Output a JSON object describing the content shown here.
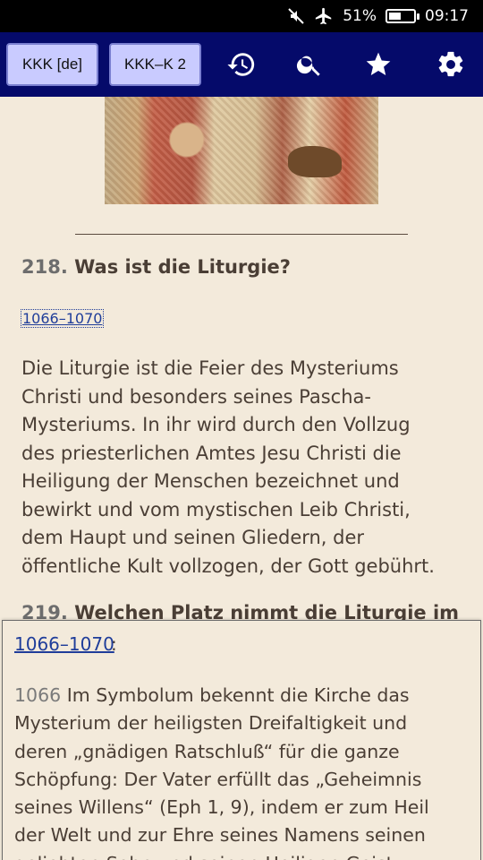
{
  "status_bar": {
    "battery_percent": "51%",
    "battery_level": 0.51,
    "time": "09:17",
    "icons": [
      "mute-icon",
      "airplane-icon",
      "battery-icon"
    ]
  },
  "toolbar": {
    "button_1": "KKK [de]",
    "button_2": "KKK–K 2",
    "icons": [
      "history-icon",
      "search-icon",
      "star-icon",
      "settings-icon"
    ]
  },
  "content": {
    "question_number": "218.",
    "question_title": "Was ist die Liturgie?",
    "reference_link": "1066–1070",
    "answer_lines": [
      "Die Liturgie ist die Feier des Mysteriums",
      "Christi und besonders seines Pascha-",
      "Mysteriums. In ihr wird durch den Vollzug",
      "des priesterlichen Amtes Jesu Christi die",
      "Heiligung der Menschen bezeichnet und",
      "bewirkt und vom mystischen Leib Christi,",
      "dem Haupt und seinen Gliedern, der",
      "öffentliche Kult vollzogen, der Gott gebührt."
    ],
    "next_question_number": "219.",
    "next_question_title": "Welchen Platz nimmt die Liturgie im"
  },
  "popup": {
    "link": "1066–1070",
    "colon": ":",
    "paragraph_number": "1066",
    "lines": [
      "Im Symbolum bekennt die Kirche das",
      "Mysterium der heiligsten Dreifaltigkeit und",
      "deren „gnädigen Ratschluß“ für die ganze",
      "Schöpfung: Der Vater erfüllt das „Geheimnis",
      "seines Willens“ (Eph 1, 9), indem er zum Heil",
      "der Welt und zur Ehre seines Namens seinen",
      "geliebten Sohn und seinen Heiligen Geist"
    ]
  }
}
